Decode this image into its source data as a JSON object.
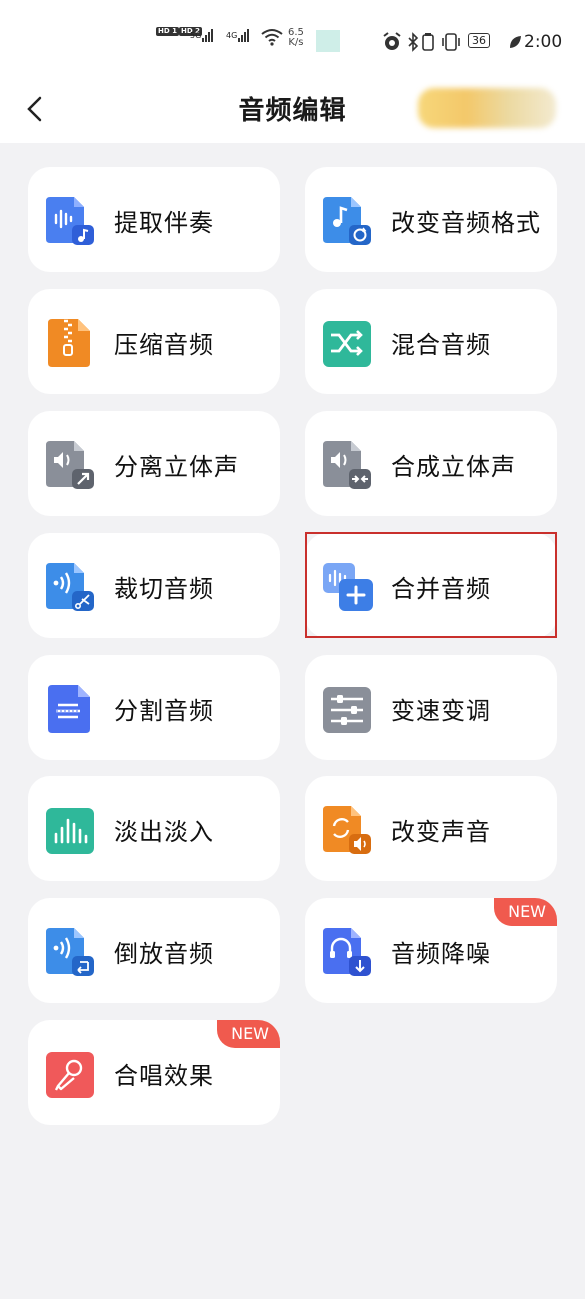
{
  "status_bar": {
    "hd1": "HD 1",
    "hd2": "HD 2",
    "net1": "5G",
    "net2": "4G",
    "speed_value": "6.5",
    "speed_unit": "K/s",
    "battery": "36",
    "time": "2:00"
  },
  "header": {
    "title": "音频编辑",
    "back_icon": "chevron-left-icon"
  },
  "tools": [
    {
      "label": "提取伴奏",
      "icon": "extract-accompaniment-icon",
      "color": "#4a7ff0"
    },
    {
      "label": "改变音频格式",
      "icon": "convert-format-icon",
      "color": "#3d8de8"
    },
    {
      "label": "压缩音频",
      "icon": "zip-icon",
      "color": "#f08a24"
    },
    {
      "label": "混合音频",
      "icon": "shuffle-icon",
      "color": "#2fb89a"
    },
    {
      "label": "分离立体声",
      "icon": "split-stereo-icon",
      "color": "#8a8f99"
    },
    {
      "label": "合成立体声",
      "icon": "merge-stereo-icon",
      "color": "#8a8f99"
    },
    {
      "label": "裁切音频",
      "icon": "cut-audio-icon",
      "color": "#3d8de8"
    },
    {
      "label": "合并音频",
      "icon": "merge-audio-icon",
      "color": "#3d7ee6"
    },
    {
      "label": "分割音频",
      "icon": "split-audio-icon",
      "color": "#4a6ff0"
    },
    {
      "label": "变速变调",
      "icon": "sliders-icon",
      "color": "#8a8f99"
    },
    {
      "label": "淡出淡入",
      "icon": "waveform-icon",
      "color": "#2fb89a"
    },
    {
      "label": "改变声音",
      "icon": "change-voice-icon",
      "color": "#f08a24"
    },
    {
      "label": "倒放音频",
      "icon": "reverse-audio-icon",
      "color": "#3d8de8"
    },
    {
      "label": "音频降噪",
      "icon": "denoise-icon",
      "color": "#4a6ff0",
      "badge": "NEW"
    },
    {
      "label": "合唱效果",
      "icon": "microphone-icon",
      "color": "#f0595a",
      "badge": "NEW"
    }
  ]
}
